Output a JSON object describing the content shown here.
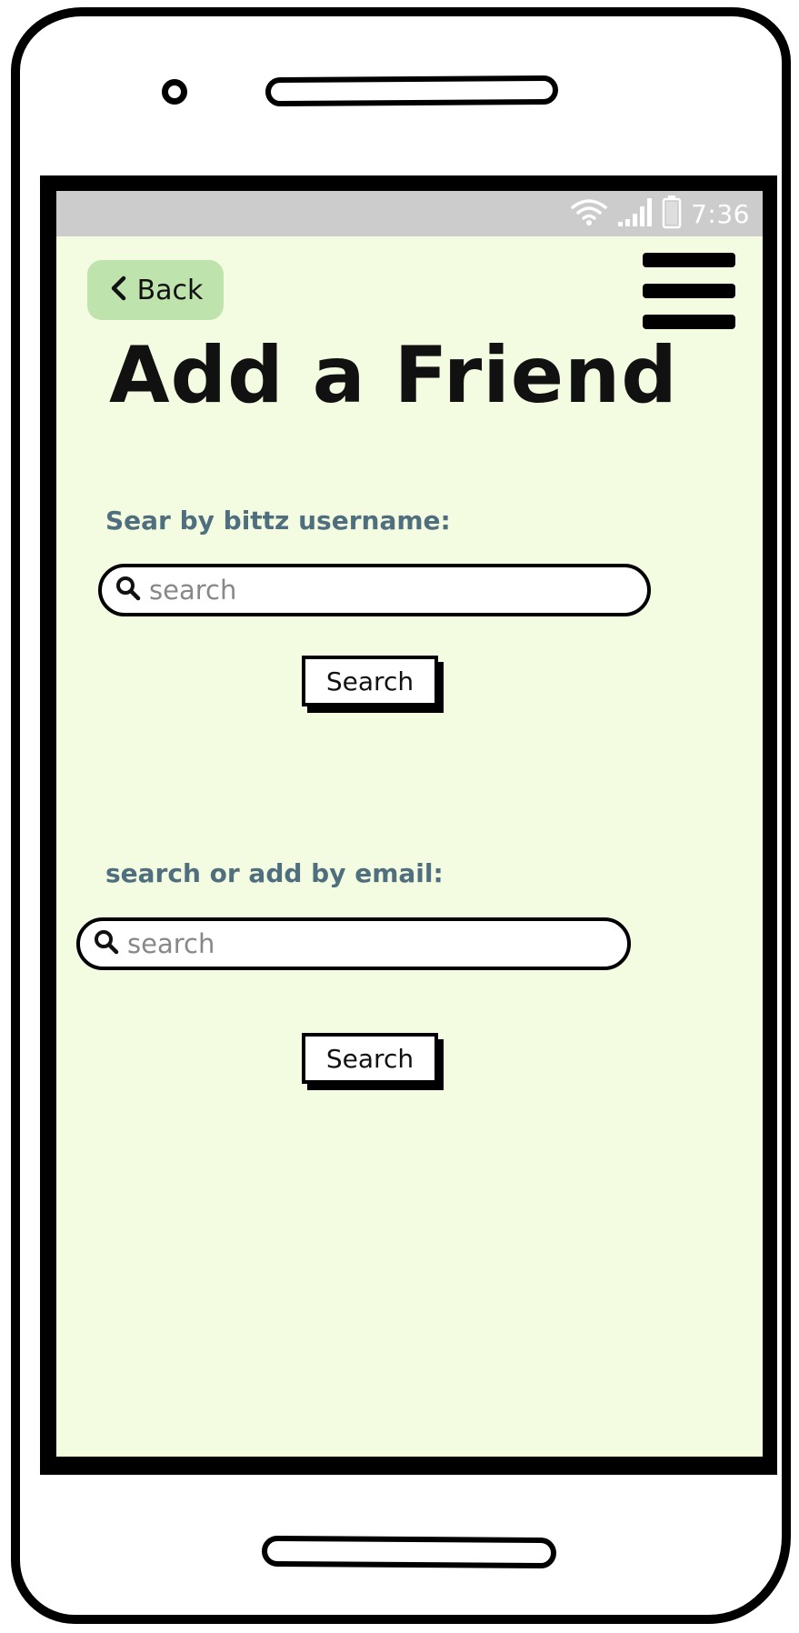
{
  "status_bar": {
    "time": "7:36",
    "icons": [
      "wifi-icon",
      "signal-icon",
      "battery-icon"
    ]
  },
  "nav": {
    "back_label": "Back",
    "menu_icon": "hamburger-menu-icon"
  },
  "page": {
    "title": "Add a Friend"
  },
  "username_search": {
    "label": "Sear by bittz username:",
    "placeholder": "search",
    "button_label": "Search"
  },
  "email_search": {
    "label": "search or add by email:",
    "placeholder": "search",
    "button_label": "Search"
  },
  "colors": {
    "screen_background": "#f3fbe0",
    "status_bar": "#cccccc",
    "back_button": "#bfe3ad",
    "section_label": "#4f6f7f"
  }
}
